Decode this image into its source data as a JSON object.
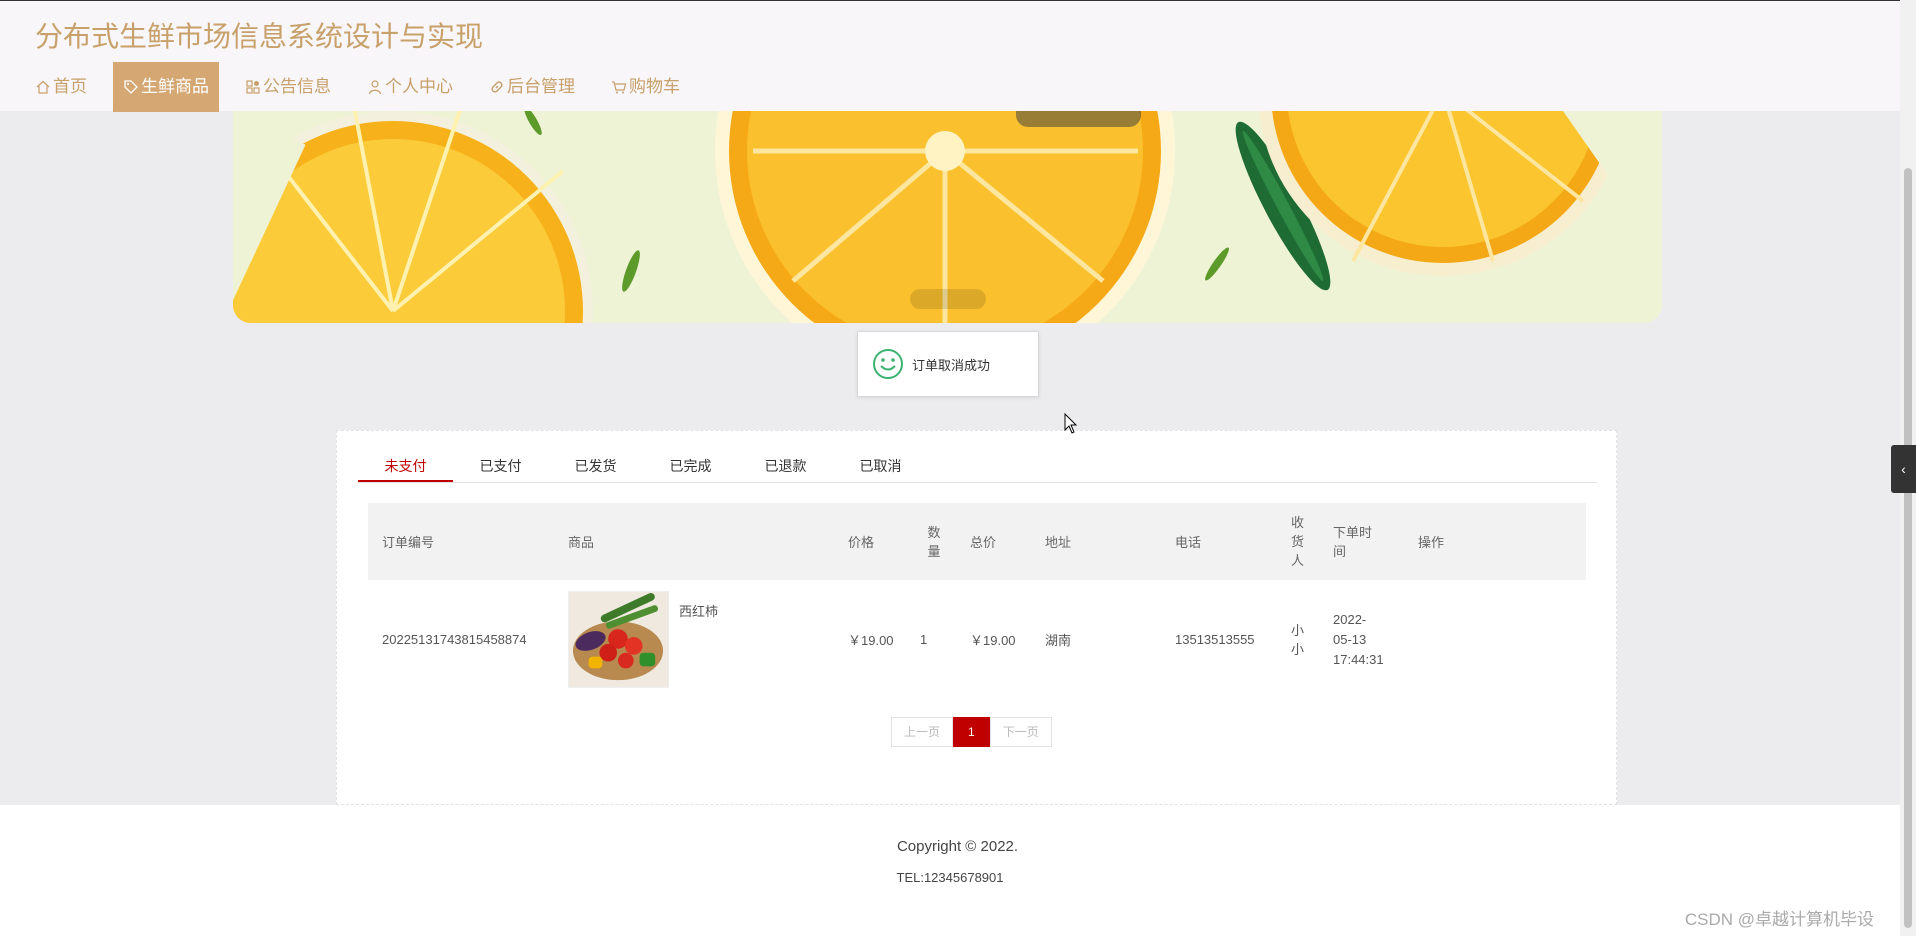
{
  "header": {
    "title": "分布式生鲜市场信息系统设计与实现",
    "nav": [
      {
        "label": "首页",
        "icon": "home-icon"
      },
      {
        "label": "生鲜商品",
        "icon": "tag-icon",
        "active": true
      },
      {
        "label": "公告信息",
        "icon": "grid-icon"
      },
      {
        "label": "个人中心",
        "icon": "user-icon"
      },
      {
        "label": "后台管理",
        "icon": "link-icon"
      },
      {
        "label": "购物车",
        "icon": "cart-icon"
      }
    ]
  },
  "toast": {
    "message": "订单取消成功",
    "icon": "smile-icon"
  },
  "tabs": [
    "未支付",
    "已支付",
    "已发货",
    "已完成",
    "已退款",
    "已取消"
  ],
  "table": {
    "headers": {
      "order_no": "订单编号",
      "goods": "商品",
      "price": "价格",
      "qty_1": "数",
      "qty_2": "量",
      "total": "总价",
      "address": "地址",
      "phone": "电话",
      "recv_1": "收",
      "recv_2": "货",
      "recv_3": "人",
      "time_1": "下单时",
      "time_2": "间",
      "action": "操作"
    },
    "rows": [
      {
        "order_no": "20225131743815458874",
        "goods_name": "西红柿",
        "price": "￥19.00",
        "qty": "1",
        "total": "￥19.00",
        "address": "湖南",
        "phone": "13513513555",
        "recv_1": "小",
        "recv_2": "小",
        "time_1": "2022-",
        "time_2": "05-13",
        "time_3": "17:44:31"
      }
    ]
  },
  "pager": {
    "prev": "上一页",
    "current": "1",
    "next": "下一页"
  },
  "footer": {
    "copyright": "Copyright © 2022.",
    "tel": "TEL:12345678901",
    "watermark": "CSDN @卓越计算机毕设"
  },
  "colors": {
    "brand": "#c7a06a",
    "nav_active": "#d4a773",
    "accent_red": "#c00000"
  }
}
